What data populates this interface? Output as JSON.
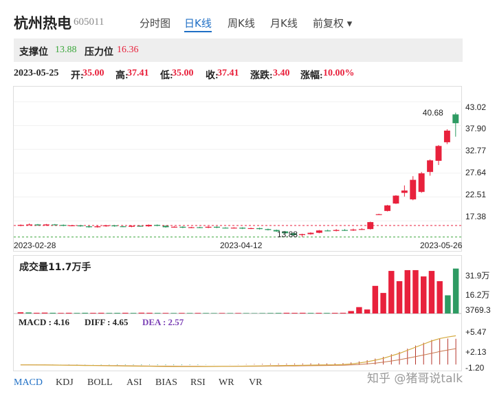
{
  "header": {
    "name": "杭州热电",
    "code": "605011",
    "tabs": [
      {
        "label": "分时图",
        "active": false
      },
      {
        "label": "日K线",
        "active": true
      },
      {
        "label": "周K线",
        "active": false
      },
      {
        "label": "月K线",
        "active": false
      }
    ],
    "adjust_label": "前复权 ▾"
  },
  "levels": {
    "support_label": "支撑位",
    "support_value": "13.88",
    "resistance_label": "压力位",
    "resistance_value": "16.36"
  },
  "quote": {
    "date": "2023-05-25",
    "open_label": "开:",
    "open": "35.00",
    "high_label": "高:",
    "high": "37.41",
    "low_label": "低:",
    "low": "35.00",
    "close_label": "收:",
    "close": "37.41",
    "change_label": "涨跌:",
    "change": "3.40",
    "pct_label": "涨幅:",
    "pct": "10.00%"
  },
  "colors": {
    "up": "#e8213c",
    "down": "#2e9b63",
    "support_line": "#3aa63a",
    "resistance_line": "#e8213c",
    "ma_line": "#d4a83c",
    "active_tab": "#1f6fc5"
  },
  "chart_data": [
    {
      "type": "candlestick",
      "title": "",
      "y_ticks": [
        "43.02",
        "37.90",
        "32.77",
        "27.64",
        "22.51",
        "17.38"
      ],
      "ylim": [
        14.0,
        43.02
      ],
      "x_ticks": [
        "2023-02-28",
        "2023-04-12",
        "2023-05-26"
      ],
      "support": 13.88,
      "resistance": 16.36,
      "support_label": "13.88",
      "max_label": "40.68",
      "candles": [
        {
          "o": 16.3,
          "c": 16.5,
          "h": 16.6,
          "l": 16.2
        },
        {
          "o": 16.5,
          "c": 16.6,
          "h": 16.8,
          "l": 16.4
        },
        {
          "o": 16.6,
          "c": 16.4,
          "h": 16.7,
          "l": 16.3
        },
        {
          "o": 16.4,
          "c": 16.6,
          "h": 16.7,
          "l": 16.3
        },
        {
          "o": 16.6,
          "c": 16.5,
          "h": 16.7,
          "l": 16.4
        },
        {
          "o": 16.5,
          "c": 16.3,
          "h": 16.6,
          "l": 16.2
        },
        {
          "o": 16.3,
          "c": 16.4,
          "h": 16.5,
          "l": 16.2
        },
        {
          "o": 16.4,
          "c": 16.2,
          "h": 16.5,
          "l": 16.1
        },
        {
          "o": 16.2,
          "c": 16.0,
          "h": 16.3,
          "l": 15.9
        },
        {
          "o": 16.0,
          "c": 16.2,
          "h": 16.3,
          "l": 15.9
        },
        {
          "o": 16.2,
          "c": 16.4,
          "h": 16.5,
          "l": 16.1
        },
        {
          "o": 16.4,
          "c": 16.2,
          "h": 16.5,
          "l": 16.1
        },
        {
          "o": 16.2,
          "c": 16.1,
          "h": 16.3,
          "l": 16.0
        },
        {
          "o": 16.1,
          "c": 16.3,
          "h": 16.4,
          "l": 16.0
        },
        {
          "o": 16.3,
          "c": 16.2,
          "h": 16.4,
          "l": 16.1
        },
        {
          "o": 16.2,
          "c": 16.5,
          "h": 16.6,
          "l": 16.1
        },
        {
          "o": 16.5,
          "c": 16.3,
          "h": 16.6,
          "l": 16.2
        },
        {
          "o": 16.3,
          "c": 16.0,
          "h": 16.4,
          "l": 15.9
        },
        {
          "o": 16.0,
          "c": 16.1,
          "h": 16.2,
          "l": 15.9
        },
        {
          "o": 16.1,
          "c": 15.9,
          "h": 16.2,
          "l": 15.8
        },
        {
          "o": 15.9,
          "c": 16.0,
          "h": 16.1,
          "l": 15.8
        },
        {
          "o": 16.0,
          "c": 15.9,
          "h": 16.1,
          "l": 15.8
        },
        {
          "o": 15.9,
          "c": 16.1,
          "h": 16.2,
          "l": 15.8
        },
        {
          "o": 16.1,
          "c": 15.9,
          "h": 16.2,
          "l": 15.8
        },
        {
          "o": 15.9,
          "c": 15.8,
          "h": 16.0,
          "l": 15.7
        },
        {
          "o": 15.8,
          "c": 15.9,
          "h": 16.0,
          "l": 15.7
        },
        {
          "o": 15.9,
          "c": 15.7,
          "h": 16.0,
          "l": 15.6
        },
        {
          "o": 15.7,
          "c": 15.8,
          "h": 15.9,
          "l": 15.6
        },
        {
          "o": 15.8,
          "c": 15.6,
          "h": 15.9,
          "l": 15.5
        },
        {
          "o": 15.6,
          "c": 15.4,
          "h": 15.7,
          "l": 15.3
        },
        {
          "o": 15.4,
          "c": 15.1,
          "h": 15.5,
          "l": 15.0
        },
        {
          "o": 15.1,
          "c": 14.7,
          "h": 15.2,
          "l": 14.6
        },
        {
          "o": 14.7,
          "c": 14.3,
          "h": 14.8,
          "l": 14.2
        },
        {
          "o": 14.3,
          "c": 14.5,
          "h": 14.6,
          "l": 13.9
        },
        {
          "o": 14.5,
          "c": 14.8,
          "h": 14.9,
          "l": 14.4
        },
        {
          "o": 14.8,
          "c": 15.3,
          "h": 15.4,
          "l": 14.7
        },
        {
          "o": 15.3,
          "c": 15.2,
          "h": 15.5,
          "l": 15.1
        },
        {
          "o": 15.2,
          "c": 15.4,
          "h": 15.6,
          "l": 15.1
        },
        {
          "o": 15.4,
          "c": 15.3,
          "h": 15.6,
          "l": 15.2
        },
        {
          "o": 15.3,
          "c": 15.5,
          "h": 15.7,
          "l": 15.2
        },
        {
          "o": 15.5,
          "c": 15.6,
          "h": 15.8,
          "l": 15.4
        },
        {
          "o": 15.6,
          "c": 17.1,
          "h": 17.2,
          "l": 15.5
        },
        {
          "o": 18.8,
          "c": 18.8,
          "h": 18.9,
          "l": 18.7
        },
        {
          "o": 19.5,
          "c": 20.7,
          "h": 20.8,
          "l": 19.4
        },
        {
          "o": 21.1,
          "c": 22.8,
          "h": 22.9,
          "l": 21.0
        },
        {
          "o": 23.4,
          "c": 23.9,
          "h": 25.0,
          "l": 22.6
        },
        {
          "o": 22.0,
          "c": 26.2,
          "h": 27.0,
          "l": 21.8
        },
        {
          "o": 23.6,
          "c": 27.6,
          "h": 27.9,
          "l": 23.4
        },
        {
          "o": 27.9,
          "c": 30.4,
          "h": 30.6,
          "l": 27.1
        },
        {
          "o": 30.3,
          "c": 33.5,
          "h": 33.7,
          "l": 29.4
        },
        {
          "o": 34.3,
          "c": 36.8,
          "h": 37.1,
          "l": 33.9
        },
        {
          "o": 40.3,
          "c": 38.4,
          "h": 40.68,
          "l": 35.5
        }
      ]
    },
    {
      "type": "bar",
      "title": "成交量11.7万手",
      "y_ticks": [
        "31.9万",
        "16.2万",
        "3769.3"
      ],
      "ylim": [
        0,
        319000
      ],
      "volumes": [
        12000,
        11000,
        9000,
        10000,
        9000,
        8000,
        9000,
        8000,
        9000,
        8500,
        9000,
        8000,
        8500,
        9000,
        8000,
        9500,
        9000,
        8000,
        8000,
        7500,
        8000,
        7500,
        8000,
        7500,
        7000,
        7500,
        7000,
        7500,
        7000,
        6500,
        7000,
        7500,
        8000,
        9000,
        8500,
        9000,
        8000,
        8500,
        8000,
        8500,
        9000,
        20000,
        45000,
        30000,
        180000,
        135000,
        275000,
        210000,
        280000,
        280000,
        240000,
        275000,
        210000,
        120000,
        290000
      ],
      "dirs": [
        1,
        0,
        1,
        1,
        0,
        1,
        1,
        0,
        0,
        1,
        1,
        0,
        0,
        1,
        0,
        1,
        1,
        0,
        1,
        0,
        1,
        0,
        1,
        0,
        0,
        1,
        0,
        1,
        0,
        0,
        0,
        0,
        0,
        1,
        1,
        1,
        0,
        1,
        0,
        1,
        1,
        1,
        1,
        1,
        1,
        1,
        1,
        1,
        1,
        1,
        1,
        1,
        1,
        0,
        0
      ]
    },
    {
      "type": "macd",
      "legend": {
        "macd": "MACD : 4.16",
        "diff": "DIFF : 4.65",
        "dea": "DEA : 2.57"
      },
      "y_ticks": [
        "+5.47",
        "+2.13",
        "-1.20"
      ],
      "ylim": [
        -1.2,
        5.47
      ],
      "diff": [
        -0.05,
        -0.06,
        -0.07,
        -0.08,
        -0.09,
        -0.1,
        -0.12,
        -0.13,
        -0.15,
        -0.16,
        -0.18,
        -0.2,
        -0.22,
        -0.24,
        -0.25,
        -0.27,
        -0.28,
        -0.3,
        -0.31,
        -0.32,
        -0.33,
        -0.33,
        -0.33,
        -0.32,
        -0.31,
        -0.3,
        -0.29,
        -0.28,
        -0.26,
        -0.24,
        -0.22,
        -0.2,
        -0.18,
        -0.16,
        -0.14,
        -0.12,
        -0.1,
        -0.08,
        -0.06,
        -0.04,
        0.0,
        0.1,
        0.25,
        0.45,
        0.7,
        1.0,
        1.4,
        1.8,
        2.3,
        2.8,
        3.3,
        3.8,
        4.2,
        4.45,
        4.65
      ],
      "dea": [
        -0.05,
        -0.05,
        -0.06,
        -0.07,
        -0.08,
        -0.09,
        -0.1,
        -0.11,
        -0.13,
        -0.14,
        -0.15,
        -0.17,
        -0.18,
        -0.2,
        -0.21,
        -0.22,
        -0.24,
        -0.25,
        -0.26,
        -0.27,
        -0.28,
        -0.29,
        -0.29,
        -0.3,
        -0.3,
        -0.3,
        -0.3,
        -0.29,
        -0.29,
        -0.28,
        -0.27,
        -0.26,
        -0.25,
        -0.23,
        -0.22,
        -0.2,
        -0.19,
        -0.17,
        -0.15,
        -0.13,
        -0.11,
        -0.07,
        0.0,
        0.1,
        0.22,
        0.38,
        0.57,
        0.78,
        1.02,
        1.27,
        1.54,
        1.81,
        2.1,
        2.35,
        2.57
      ],
      "hist": [
        0,
        -0.02,
        -0.02,
        -0.02,
        -0.02,
        -0.02,
        -0.04,
        -0.04,
        -0.04,
        -0.04,
        -0.06,
        -0.06,
        -0.08,
        -0.08,
        -0.08,
        -0.1,
        -0.08,
        -0.1,
        -0.1,
        -0.1,
        -0.1,
        -0.08,
        -0.08,
        -0.04,
        -0.02,
        0,
        0.02,
        0.02,
        0.06,
        0.08,
        0.1,
        0.12,
        0.14,
        0.14,
        0.16,
        0.16,
        0.18,
        0.18,
        0.18,
        0.18,
        0.22,
        0.34,
        0.5,
        0.7,
        0.96,
        1.24,
        1.66,
        2.04,
        2.56,
        3.06,
        3.52,
        3.98,
        4.2,
        4.2,
        4.16
      ]
    }
  ],
  "indicator_tabs": [
    "MACD",
    "KDJ",
    "BOLL",
    "ASI",
    "BIAS",
    "RSI",
    "WR",
    "VR"
  ],
  "watermark": "知乎 @猪哥说talk"
}
